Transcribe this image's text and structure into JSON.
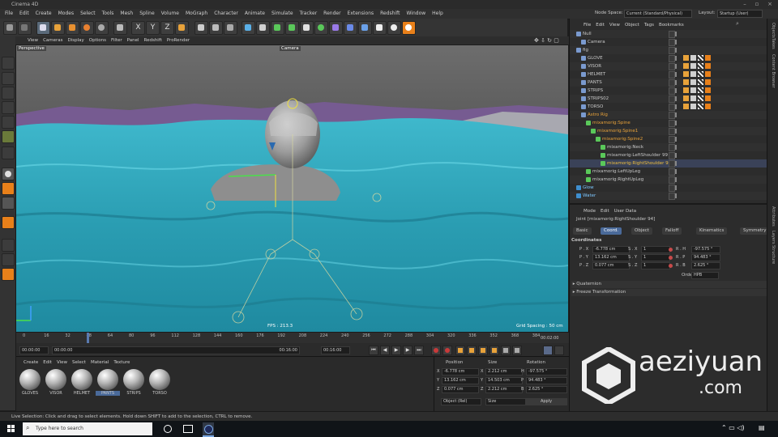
{
  "window": {
    "title": "Cinema 4D"
  },
  "menu": [
    "File",
    "Edit",
    "Create",
    "Modes",
    "Select",
    "Tools",
    "Mesh",
    "Spline",
    "Volume",
    "MoGraph",
    "Character",
    "Animate",
    "Simulate",
    "Tracker",
    "Render",
    "Extensions",
    "Redshift",
    "Window",
    "Help"
  ],
  "nodespace": {
    "label": "Node Space:",
    "value": "Current (Standard/Physical)"
  },
  "layout": {
    "label": "Layout:",
    "value": "Startup (User)"
  },
  "viewport": {
    "menu": [
      "View",
      "Cameras",
      "Display",
      "Options",
      "Filter",
      "Panel",
      "Redshift",
      "ProRender"
    ],
    "name": "Perspective",
    "camera": "Camera",
    "fps": "FPS : 213.3",
    "grid": "Grid Spacing : 50 cm"
  },
  "timeline": {
    "ticks": [
      "0",
      "16",
      "32",
      "48",
      "64",
      "80",
      "96",
      "112",
      "128",
      "144",
      "160",
      "176",
      "192",
      "208",
      "224",
      "240",
      "256",
      "272",
      "288",
      "304",
      "320",
      "336",
      "352",
      "368",
      "384"
    ],
    "end_frame": "00:02:00"
  },
  "transport": {
    "start": "00:00:00",
    "current": "00:00:00",
    "range_end": "00:16:00",
    "end": "00:16:00"
  },
  "materials": {
    "menu": [
      "Create",
      "Edit",
      "View",
      "Select",
      "Material",
      "Texture"
    ],
    "items": [
      "GLOVES",
      "VISOR",
      "HELMET",
      "PANTS",
      "STRIPS",
      "TORSO"
    ]
  },
  "coords": {
    "headers": [
      "Position",
      "Size",
      "Rotation"
    ],
    "rows": [
      {
        "axis": "X",
        "pos": "-6.778 cm",
        "size": "2.212 cm",
        "rot_axis": "H",
        "rot": "-97.575 °"
      },
      {
        "axis": "Y",
        "pos": "13.162 cm",
        "size": "14.503 cm",
        "rot_axis": "P",
        "rot": "94.483 °"
      },
      {
        "axis": "Z",
        "pos": "0.077 cm",
        "size": "2.212 cm",
        "rot_axis": "B",
        "rot": "2.625 °"
      }
    ],
    "mode": "Object (Rel)",
    "size_mode": "Size",
    "apply": "Apply"
  },
  "objects": {
    "menu": [
      "File",
      "Edit",
      "View",
      "Object",
      "Tags",
      "Bookmarks"
    ],
    "rows": [
      {
        "name": "Null",
        "indent": 0,
        "color": "#c8c8c8"
      },
      {
        "name": "Camera",
        "indent": 1,
        "color": "#c8c8c8"
      },
      {
        "name": "fig",
        "indent": 0,
        "color": "#c8c8c8"
      },
      {
        "name": "GLOVE",
        "indent": 1,
        "color": "#c8c8c8"
      },
      {
        "name": "VISOR",
        "indent": 1,
        "color": "#c8c8c8"
      },
      {
        "name": "HELMET",
        "indent": 1,
        "color": "#c8c8c8"
      },
      {
        "name": "PANTS",
        "indent": 1,
        "color": "#c8c8c8"
      },
      {
        "name": "STRIPS",
        "indent": 1,
        "color": "#c8c8c8"
      },
      {
        "name": "STRIPS02",
        "indent": 1,
        "color": "#c8c8c8"
      },
      {
        "name": "TORSO",
        "indent": 1,
        "color": "#c8c8c8"
      },
      {
        "name": "Astro Rig",
        "indent": 1,
        "color": "#e8a23a"
      },
      {
        "name": "mixamorig:Spine",
        "indent": 2,
        "color": "#e8a23a"
      },
      {
        "name": "mixamorig:Spine1",
        "indent": 3,
        "color": "#e8a23a"
      },
      {
        "name": "mixamorig:Spine2",
        "indent": 4,
        "color": "#e8a23a"
      },
      {
        "name": "mixamorig:Neck",
        "indent": 5,
        "color": "#c8c8c8"
      },
      {
        "name": "mixamorig:LeftShoulder 99",
        "indent": 5,
        "color": "#c8c8c8"
      },
      {
        "name": "mixamorig:RightShoulder 94",
        "indent": 5,
        "color": "#f0c040"
      },
      {
        "name": "mixamorig:LeftUpLeg",
        "indent": 2,
        "color": "#c8c8c8"
      },
      {
        "name": "mixamorig:RightUpLeg",
        "indent": 2,
        "color": "#c8c8c8"
      },
      {
        "name": "Glow",
        "indent": 0,
        "color": "#7fc8ff"
      },
      {
        "name": "Water",
        "indent": 0,
        "color": "#7fc8ff"
      }
    ]
  },
  "attributes": {
    "menu": [
      "Mode",
      "Edit",
      "User Data"
    ],
    "title": "Joint [mixamorig:RightShoulder 94]",
    "tabs": [
      "Basic",
      "Coord.",
      "Object",
      "Falloff",
      "Kinematics",
      "Symmetry"
    ],
    "active_tab": "Coord.",
    "section": "Coordinates",
    "rows": [
      {
        "p": "P . X",
        "pv": "-6.778 cm",
        "s": "S . X",
        "sv": "1",
        "r": "R . H",
        "rv": "-97.575 °"
      },
      {
        "p": "P . Y",
        "pv": "13.162 cm",
        "s": "S . Y",
        "sv": "1",
        "r": "R . P",
        "rv": "94.483 °"
      },
      {
        "p": "P . Z",
        "pv": "0.077 cm",
        "s": "S . Z",
        "sv": "1",
        "r": "R . B",
        "rv": "2.625 °"
      }
    ],
    "order_label": "Order",
    "order_value": "HPB",
    "groups": [
      "Quaternion",
      "Freeze Transformation"
    ]
  },
  "sidebar": {
    "labels": [
      "Objects",
      "Takes",
      "Content Browser",
      "Attributes",
      "Layers",
      "Structure"
    ]
  },
  "status": "Live Selection: Click and drag to select elements. Hold down SHIFT to add to the selection, CTRL to remove.",
  "taskbar": {
    "search": "Type here to search"
  },
  "watermark": {
    "line1": "aeziyuan",
    "line2": ".com"
  }
}
